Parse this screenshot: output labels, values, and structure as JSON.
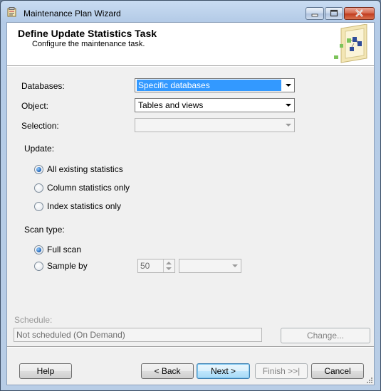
{
  "window": {
    "title": "Maintenance Plan Wizard"
  },
  "header": {
    "title": "Define Update Statistics Task",
    "subtitle": "Configure the maintenance task."
  },
  "form": {
    "databases_label": "Databases:",
    "databases_value": "Specific databases",
    "object_label": "Object:",
    "object_value": "Tables and views",
    "selection_label": "Selection:",
    "selection_value": "",
    "update_label": "Update:",
    "update_options": [
      "All existing statistics",
      "Column statistics only",
      "Index statistics only"
    ],
    "update_selected": "All existing statistics",
    "scan_type_label": "Scan type:",
    "scan_options": [
      "Full scan",
      "Sample by"
    ],
    "scan_selected": "Full scan",
    "sample_value": "50",
    "sample_unit": ""
  },
  "schedule": {
    "label": "Schedule:",
    "value": "Not scheduled (On Demand)",
    "change_label": "Change..."
  },
  "buttons": {
    "help": "Help",
    "back": "< Back",
    "next": "Next >",
    "finish": "Finish >>|",
    "cancel": "Cancel"
  },
  "colors": {
    "accent": "#3399ff",
    "header_bg": "#ffffff",
    "dialog_bg": "#f0f0f0"
  }
}
